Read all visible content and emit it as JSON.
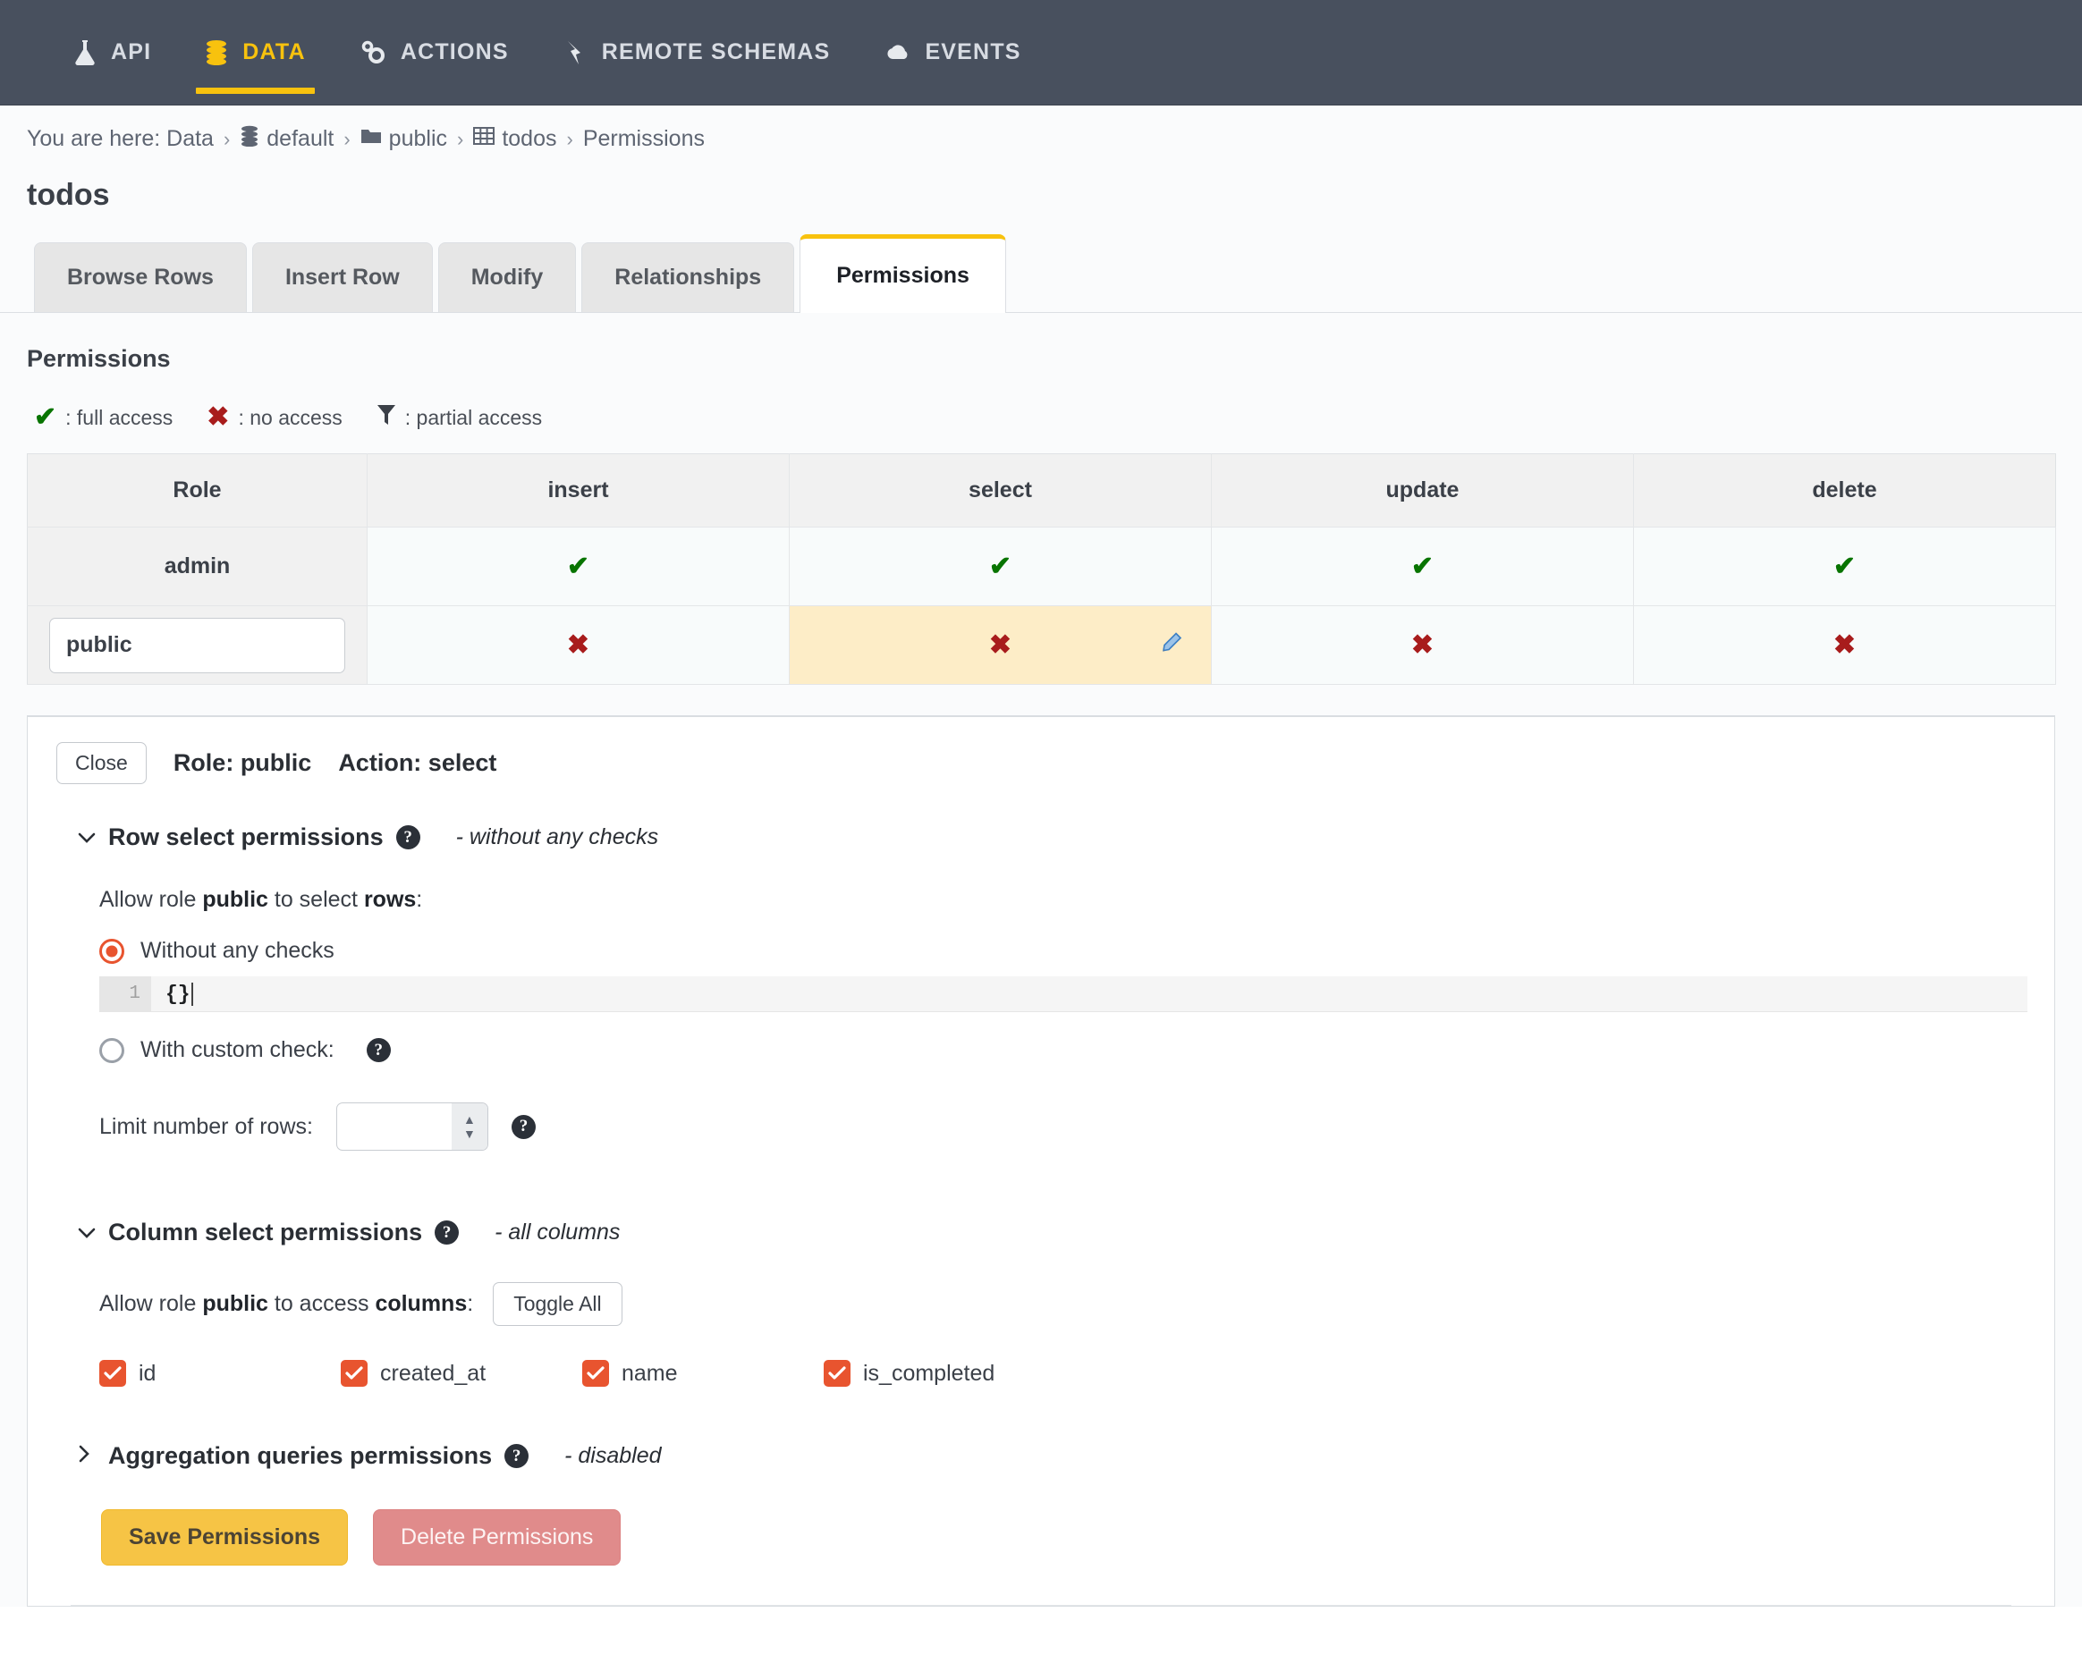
{
  "nav": {
    "items": [
      {
        "label": "API",
        "icon": "flask-icon",
        "active": false
      },
      {
        "label": "DATA",
        "icon": "database-icon",
        "active": true
      },
      {
        "label": "ACTIONS",
        "icon": "gears-icon",
        "active": false
      },
      {
        "label": "REMOTE SCHEMAS",
        "icon": "plug-icon",
        "active": false
      },
      {
        "label": "EVENTS",
        "icon": "cloud-icon",
        "active": false
      }
    ],
    "accent_color": "#f8c20e",
    "background_color": "#48505e"
  },
  "breadcrumb": {
    "prefix": "You are here: Data",
    "sep": "›",
    "items": [
      {
        "label": "default",
        "icon": "database-icon"
      },
      {
        "label": "public",
        "icon": "folder-icon"
      },
      {
        "label": "todos",
        "icon": "table-icon"
      },
      {
        "label": "Permissions",
        "icon": ""
      }
    ]
  },
  "page_title": "todos",
  "tabs": [
    {
      "label": "Browse Rows",
      "active": false
    },
    {
      "label": "Insert Row",
      "active": false
    },
    {
      "label": "Modify",
      "active": false
    },
    {
      "label": "Relationships",
      "active": false
    },
    {
      "label": "Permissions",
      "active": true
    }
  ],
  "permissions": {
    "heading": "Permissions",
    "legend": [
      {
        "icon": "check-icon",
        "glyph": "✔",
        "label": ": full access",
        "color": "#087400"
      },
      {
        "icon": "cross-icon",
        "glyph": "✖",
        "label": ": no access",
        "color": "#a81c1c"
      },
      {
        "icon": "funnel-icon",
        "glyph": "",
        "label": ": partial access",
        "color": "#3b4048"
      }
    ],
    "table": {
      "columns": [
        "Role",
        "insert",
        "select",
        "update",
        "delete"
      ],
      "rows": [
        {
          "role": "admin",
          "role_is_input": false,
          "cells": [
            {
              "state": "full",
              "glyph": "✔",
              "highlight": false,
              "edit": false
            },
            {
              "state": "full",
              "glyph": "✔",
              "highlight": false,
              "edit": false
            },
            {
              "state": "full",
              "glyph": "✔",
              "highlight": false,
              "edit": false
            },
            {
              "state": "full",
              "glyph": "✔",
              "highlight": false,
              "edit": false
            }
          ]
        },
        {
          "role": "public",
          "role_is_input": true,
          "cells": [
            {
              "state": "none",
              "glyph": "✖",
              "highlight": false,
              "edit": false
            },
            {
              "state": "none",
              "glyph": "✖",
              "highlight": true,
              "edit": true
            },
            {
              "state": "none",
              "glyph": "✖",
              "highlight": false,
              "edit": false
            },
            {
              "state": "none",
              "glyph": "✖",
              "highlight": false,
              "edit": false
            }
          ]
        }
      ]
    }
  },
  "editor": {
    "close_label": "Close",
    "role_label": "Role: public",
    "action_label": "Action: select",
    "row_section": {
      "chevron": "⌄",
      "title": "Row select permissions",
      "note": "- without any checks",
      "allow_prefix": "Allow role ",
      "allow_role": "public",
      "allow_mid": " to select ",
      "allow_target": "rows",
      "allow_suffix": ":",
      "option_without": "Without any checks",
      "option_custom": "With custom check:",
      "code_line_number": "1",
      "code_value": "{}",
      "limit_label": "Limit number of rows:",
      "limit_value": ""
    },
    "column_section": {
      "chevron": "⌄",
      "title": "Column select permissions",
      "note": "- all columns",
      "allow_prefix": "Allow role ",
      "allow_role": "public",
      "allow_mid": " to access ",
      "allow_target": "columns",
      "allow_suffix": ":",
      "toggle_all_label": "Toggle All",
      "columns": [
        {
          "name": "id",
          "checked": true
        },
        {
          "name": "created_at",
          "checked": true
        },
        {
          "name": "name",
          "checked": true
        },
        {
          "name": "is_completed",
          "checked": true
        }
      ]
    },
    "aggregation_section": {
      "chevron": "›",
      "title": "Aggregation queries permissions",
      "note": "- disabled"
    },
    "save_label": "Save Permissions",
    "delete_label": "Delete Permissions"
  },
  "colors": {
    "accent_yellow": "#f8c20e",
    "save_yellow": "#f6c445",
    "delete_red": "#e08b8b",
    "checkbox_orange": "#e8542f",
    "highlight_cream": "#fdedc7",
    "nav_bg": "#48505e"
  }
}
